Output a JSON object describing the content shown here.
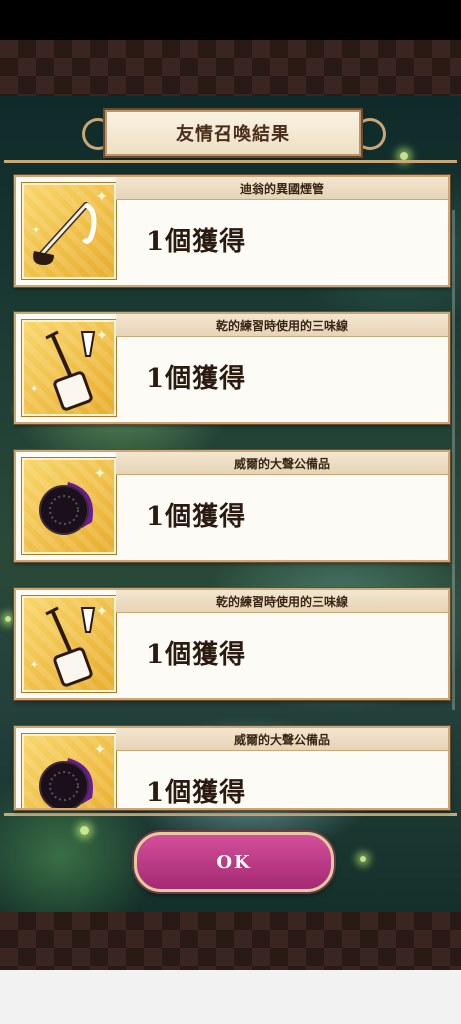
{
  "dialog": {
    "title": "友情召喚結果"
  },
  "results": [
    {
      "item_name": "迪翁的異國煙管",
      "amount": "1個獲得",
      "icon": "pipe-icon"
    },
    {
      "item_name": "乾的練習時使用的三味線",
      "amount": "1個獲得",
      "icon": "shamisen-icon"
    },
    {
      "item_name": "威爾的大聲公備品",
      "amount": "1個獲得",
      "icon": "megaphone-icon"
    },
    {
      "item_name": "乾的練習時使用的三味線",
      "amount": "1個獲得",
      "icon": "shamisen-icon"
    },
    {
      "item_name": "威爾的大聲公備品",
      "amount": "1個獲得",
      "icon": "megaphone-icon"
    }
  ],
  "buttons": {
    "ok_label": "OK"
  },
  "colors": {
    "ok_button": "#c13e8a",
    "frame_gold": "#c9a777",
    "thumb_gold": "#f2c24a"
  }
}
